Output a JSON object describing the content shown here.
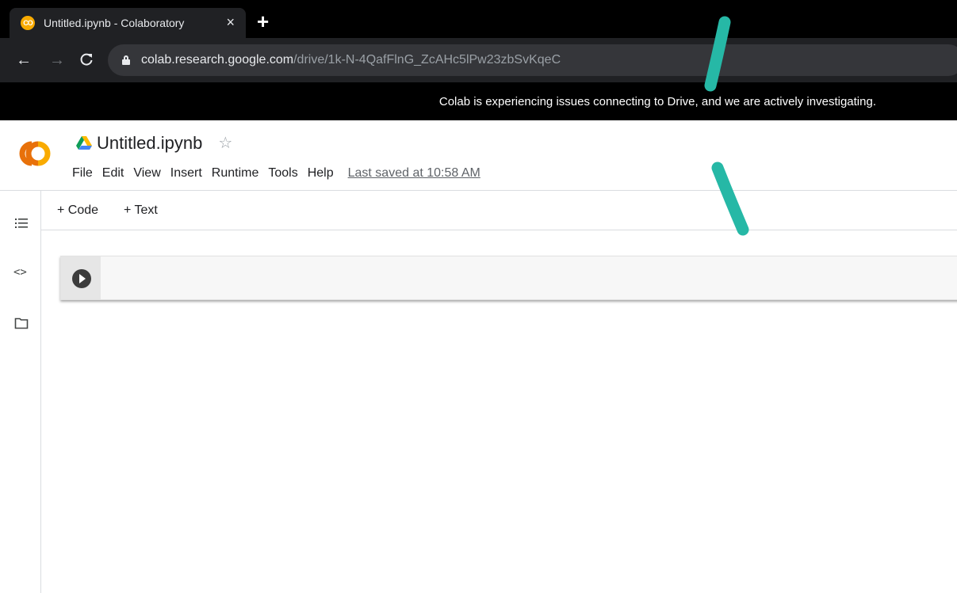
{
  "browser": {
    "tab": {
      "title": "Untitled.ipynb - Colaboratory",
      "favicon_text": "CO",
      "close_glyph": "×"
    },
    "new_tab_glyph": "+",
    "nav": {
      "back_glyph": "←",
      "forward_glyph": "→",
      "reload_glyph": "C"
    },
    "url": {
      "host": "colab.research.google.com",
      "path": "/drive/1k-N-4QafFlnG_ZcAHc5lPw23zbSvKqeC"
    },
    "banner": "Colab is experiencing issues connecting to Drive, and we are actively investigating."
  },
  "colab": {
    "logo_text": "CO",
    "doc_title": "Untitled.ipynb",
    "star_glyph": "☆",
    "menu": [
      "File",
      "Edit",
      "View",
      "Insert",
      "Runtime",
      "Tools",
      "Help"
    ],
    "last_saved": "Last saved at 10:58 AM",
    "toolbar": {
      "add_code": "+ Code",
      "add_text": "+ Text"
    },
    "rail": {
      "code_glyph": "<>"
    }
  },
  "colors": {
    "logo_orange": "#f9ab00",
    "logo_dark_orange": "#e8710a",
    "annotation_teal": "#26b8a6",
    "chrome_bg": "#202124"
  }
}
